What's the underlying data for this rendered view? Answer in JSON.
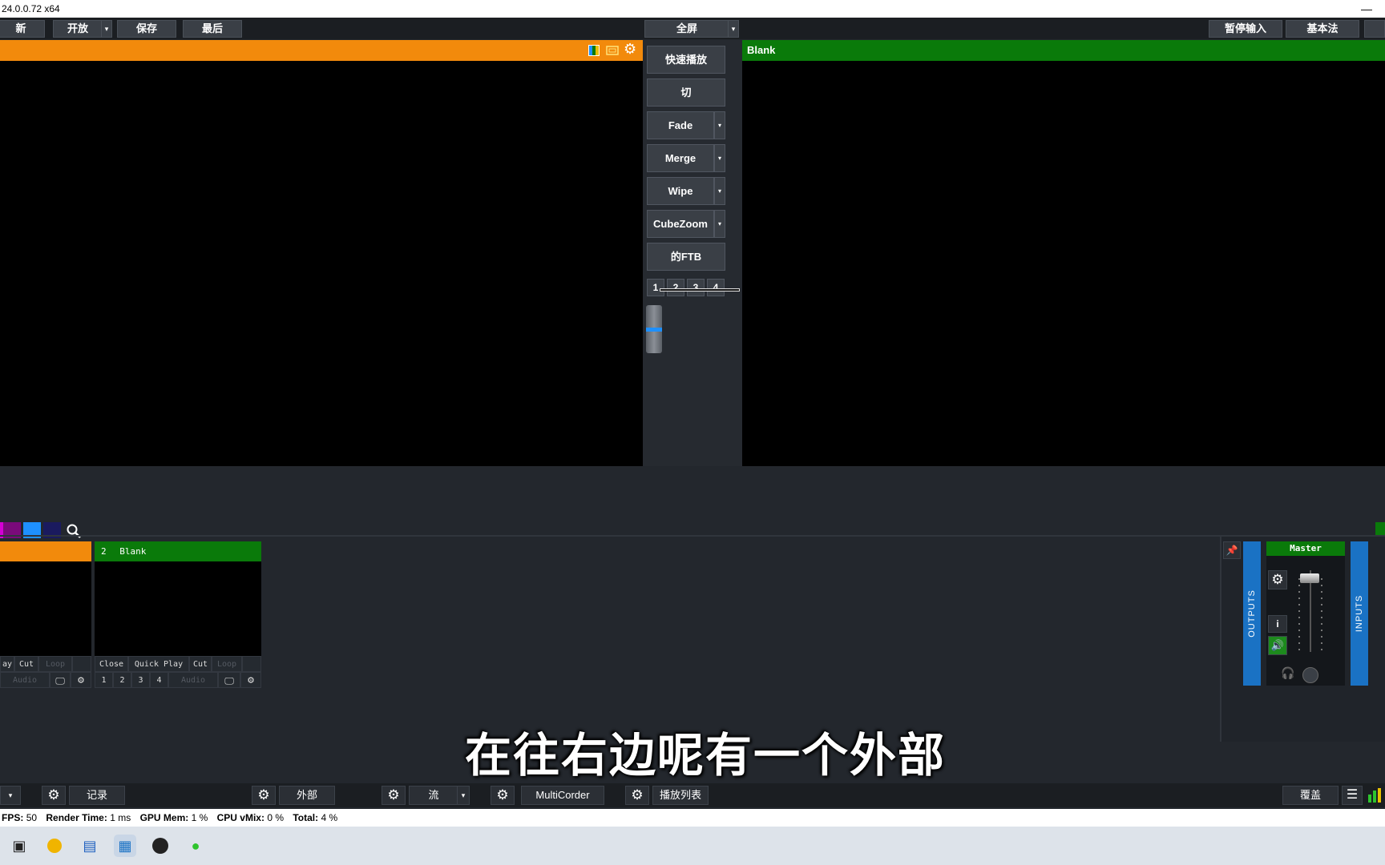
{
  "title_bar": {
    "title": "24.0.0.72 x64",
    "minimize": "—"
  },
  "top_bar": {
    "new_label": "新",
    "open_label": "开放",
    "save_label": "保存",
    "last_label": "最后",
    "fullscreen_label": "全屏",
    "pause_input_label": "暂停输入",
    "basic_label": "基本法"
  },
  "output": {
    "title": "Blank"
  },
  "transitions": {
    "quick_play": "快速播放",
    "cut": "切",
    "fade": "Fade",
    "merge": "Merge",
    "wipe": "Wipe",
    "cubezoom": "CubeZoom",
    "ftb": "的FTB",
    "numbers": [
      "1",
      "2",
      "3",
      "4"
    ]
  },
  "swatch_colors": [
    "#d400d4",
    "#7a0a7a",
    "#1e90ff",
    "#1a1a5e"
  ],
  "inputs": [
    {
      "number": "",
      "title": "",
      "header_color": "#f28a0c",
      "controls": [
        "ay",
        "Cut",
        "Loop"
      ],
      "sub": [
        "Audio"
      ]
    },
    {
      "number": "2",
      "title": "Blank",
      "header_color": "#0a7a0a",
      "controls": [
        "Close",
        "Quick Play",
        "Cut",
        "Loop"
      ],
      "sub": [
        "1",
        "2",
        "3",
        "4",
        "Audio"
      ]
    }
  ],
  "audio": {
    "outputs_label": "OUTPUTS",
    "inputs_label": "INPUTS",
    "master_label": "Master",
    "info_label": "i"
  },
  "subtitle": "在往右边呢有一个外部",
  "bottom_bar": {
    "record_label": "记录",
    "external_label": "外部",
    "stream_label": "流",
    "multicorder_label": "MultiCorder",
    "playlist_label": "播放列表",
    "overlay_label": "覆盖"
  },
  "status": {
    "fps_label": "FPS:",
    "fps_value": "50",
    "render_label": "Render Time:",
    "render_value": "1 ms",
    "gpu_label": "GPU Mem:",
    "gpu_value": "1 %",
    "cpu_label": "CPU vMix:",
    "cpu_value": "0 %",
    "total_label": "Total:",
    "total_value": "4 %"
  }
}
